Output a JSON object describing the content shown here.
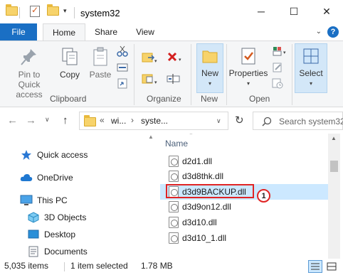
{
  "window": {
    "title": "system32",
    "minimize_glyph": "─",
    "maximize_glyph": "☐",
    "close_glyph": "✕",
    "qa_dropdown_glyph": "▾"
  },
  "tabs": {
    "file": "File",
    "home": "Home",
    "share": "Share",
    "view": "View",
    "help_glyph": "?"
  },
  "ribbon": {
    "clipboard": {
      "label": "Clipboard",
      "pin": "Pin to Quick access",
      "copy": "Copy",
      "paste": "Paste"
    },
    "organize": {
      "label": "Organize"
    },
    "new": {
      "label": "New",
      "button": "New"
    },
    "open": {
      "label": "Open",
      "properties": "Properties"
    },
    "select": {
      "button": "Select"
    }
  },
  "address": {
    "root_glyph": "«",
    "segments": [
      "wi...",
      "syste..."
    ],
    "search_placeholder": "Search system32"
  },
  "nav_pane": {
    "items": [
      {
        "label": "Quick access",
        "icon": "star-icon"
      },
      {
        "label": "OneDrive",
        "icon": "cloud-icon"
      },
      {
        "label": "This PC",
        "icon": "pc-icon"
      },
      {
        "label": "3D Objects",
        "icon": "cube-icon"
      },
      {
        "label": "Desktop",
        "icon": "desktop-icon"
      },
      {
        "label": "Documents",
        "icon": "document-icon"
      }
    ]
  },
  "file_list": {
    "column_name": "Name",
    "files": [
      "d2d1.dll",
      "d3d8thk.dll",
      "d3d9BACKUP.dll",
      "d3d9on12.dll",
      "d3d10.dll",
      "d3d10_1.dll"
    ],
    "selected_index": 2,
    "callout_number": "1"
  },
  "status_bar": {
    "item_count": "5,035 items",
    "selection": "1 item selected",
    "size": "1.78 MB"
  },
  "colors": {
    "file_tab": "#1a6fc4",
    "selection": "#cce8ff",
    "highlight": "#e02424"
  }
}
